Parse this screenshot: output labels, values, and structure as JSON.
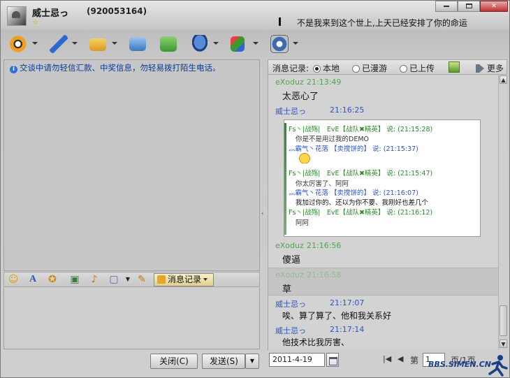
{
  "header": {
    "nickname": "威士忌っ",
    "qq_number": "(920053164)",
    "signature": "不是我来到这个世上,上天已经安排了你的命运"
  },
  "toolbar": {
    "items": [
      {
        "icon": "video-camera-icon"
      },
      {
        "icon": "microphone-icon"
      },
      {
        "icon": "send-file-icon"
      },
      {
        "icon": "email-icon"
      },
      {
        "icon": "create-group-icon"
      },
      {
        "icon": "remote-assist-icon"
      },
      {
        "icon": "apps-icon"
      },
      {
        "icon": "settings-icon"
      }
    ]
  },
  "notice": "交谈中请勿轻信汇款、中奖信息，勿轻易拨打陌生电话。",
  "input_toolbar": {
    "history_label": "消息记录"
  },
  "buttons": {
    "close_label": "关闭(C)",
    "send_label": "发送(S)"
  },
  "history_panel": {
    "label": "消息记录:",
    "options": [
      "本地",
      "已漫游",
      "已上传"
    ],
    "selected": "本地",
    "more_label": "更多"
  },
  "messages": [
    {
      "sender": "eXoduz",
      "time": "21:13:49",
      "text": "太恶心了",
      "color": "#4aa84a"
    },
    {
      "sender": "威士忌っ",
      "time": "21:16:25",
      "text": "",
      "color": "#2a55c8"
    },
    {
      "sender": "eXoduz",
      "time": "21:16:56",
      "text": "傻逼",
      "color": "#4aa84a"
    },
    {
      "sender": "eXoduz",
      "time": "21:16:58",
      "text": "草",
      "color": "#8fbf8f"
    },
    {
      "sender": "威士忌っ",
      "time": "21:17:07",
      "text": "唉、算了算了、他和我关系好",
      "color": "#2a55c8"
    },
    {
      "sender": "威士忌っ",
      "time": "21:17:14",
      "text": "他技术比我厉害、",
      "color": "#2a55c8"
    }
  ],
  "embedded_screenshot": {
    "lines": [
      "Fs丶|战殇|　EvE【战队✖精英】 说: (21:15:28)",
      "你是不是用过我的DEMO",
      "灬霸气丶花落 【卖搅饼的】 说: (21:15:37)",
      "Fs丶|战殇|　EvE【战队✖精英】 说: (21:15:47)",
      "你太厉害了、阿阿",
      "灬霸气丶花落 【卖搅饼的】 说: (21:16:07)",
      "我加过你的、还以为你不要、我刚好也差几个",
      "Fs丶|战殇|　EvE【战队✖精英】 说: (21:16:12)",
      "阿阿"
    ]
  },
  "footer": {
    "date": "2011-4-19",
    "page_prefix": "第",
    "page_value": "1",
    "page_suffix": "页/1页",
    "watermark": "BBS.SIMEN.CN"
  }
}
